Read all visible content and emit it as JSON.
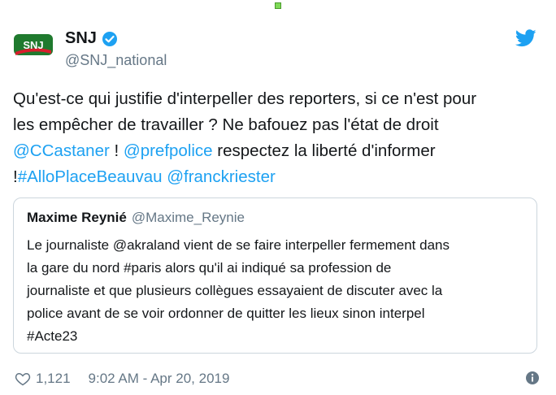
{
  "author": {
    "display_name": "SNJ",
    "handle": "@SNJ_national",
    "avatar_text": "SNJ"
  },
  "tweet": {
    "line1": "Qu'est-ce qui justifie d'interpeller des reporters, si ce n'est pour",
    "line2": "les empêcher de travailler ? Ne bafouez pas l'état de droit",
    "mention1": "@CCastaner",
    "sep1": " ! ",
    "mention2": "@prefpolice",
    "line3_rest": " respectez la liberté d'informer",
    "bang": "!",
    "hashtag": "#AlloPlaceBeauvau",
    "space": " ",
    "mention3": "@franckriester"
  },
  "quote": {
    "name": "Maxime Reynié",
    "handle": "@Maxime_Reynie",
    "lines": [
      "Le journaliste @akraland vient de se faire interpeller fermement dans",
      "la gare du nord #paris alors qu'il ai indiqué sa profession de",
      "journaliste et que plusieurs collègues essayaient de discuter avec la",
      "police avant de se voir ordonner de quitter les lieux sinon interpel",
      "#Acte23"
    ]
  },
  "footer": {
    "likes": "1,121",
    "timestamp": "9:02 AM - Apr 20, 2019"
  },
  "icons": {
    "verified": "verified-badge-icon",
    "bird": "twitter-bird-icon",
    "heart": "heart-icon",
    "info": "info-icon"
  },
  "colors": {
    "link": "#1da1f2",
    "secondary": "#657786",
    "border": "#ccd6dd",
    "avatar_green": "#1f7a2e",
    "avatar_red": "#d81e2c"
  }
}
